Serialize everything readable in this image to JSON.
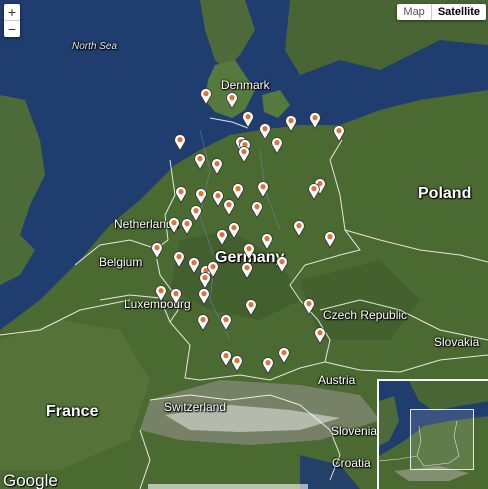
{
  "map": {
    "type_selector": {
      "map_label": "Map",
      "satellite_label": "Satellite",
      "active": "Satellite"
    },
    "zoom": {
      "in_label": "+",
      "out_label": "−"
    },
    "attribution_logo": "Google",
    "labels": {
      "north_sea": "North Sea",
      "denmark": "Denmark",
      "netherlands": "Netherlands",
      "belgium": "Belgium",
      "germany": "Germany",
      "poland": "Poland",
      "luxembourg": "Luxembourg",
      "czech_republic": "Czech Republic",
      "slovakia": "Slovakia",
      "austria": "Austria",
      "france": "France",
      "switzerland": "Switzerland",
      "slovenia": "Slovenia",
      "croatia": "Croatia"
    },
    "marker_count": 52,
    "colors": {
      "sea": "#1f3d6e",
      "land": "#4b6a32",
      "border": "#ffffff",
      "pin_body": "#ffffff",
      "pin_dot": "#e0703a"
    }
  }
}
